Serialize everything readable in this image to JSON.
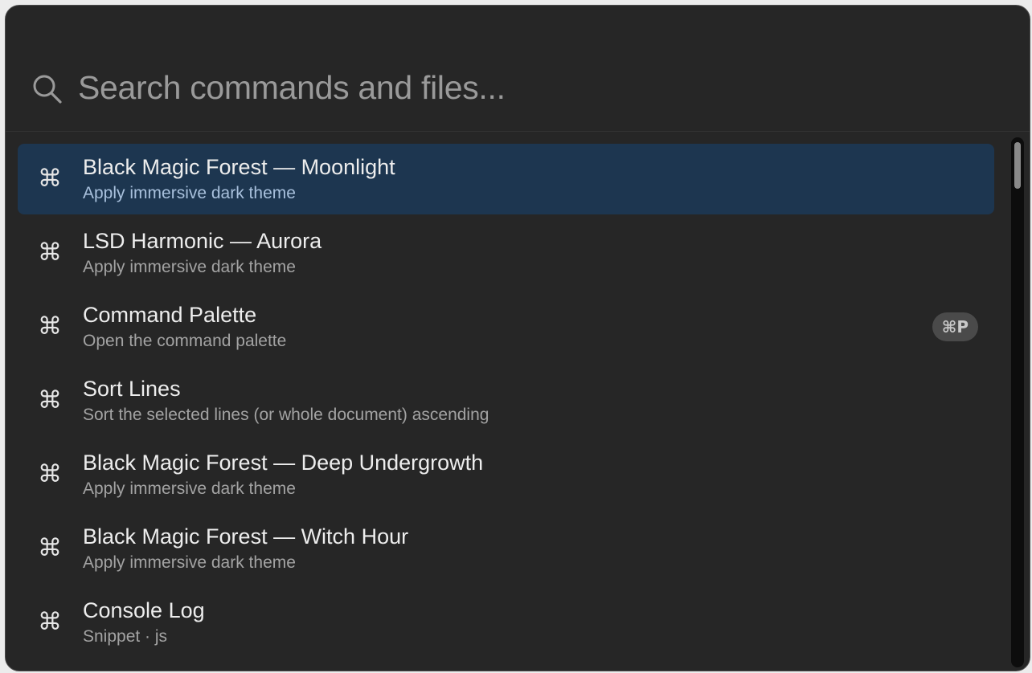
{
  "search": {
    "placeholder": "Search commands and files...",
    "icon": "search-icon"
  },
  "results": [
    {
      "icon": "command-key-icon",
      "glyph": "⌘",
      "title": "Black Magic Forest — Moonlight",
      "subtitle": "Apply immersive dark theme",
      "selected": true
    },
    {
      "icon": "command-key-icon",
      "glyph": "⌘",
      "title": "LSD Harmonic — Aurora",
      "subtitle": "Apply immersive dark theme"
    },
    {
      "icon": "command-key-icon",
      "glyph": "⌘",
      "title": "Command Palette",
      "subtitle": "Open the command palette",
      "shortcut": "⌘P"
    },
    {
      "icon": "command-key-icon",
      "glyph": "⌘",
      "title": "Sort Lines",
      "subtitle": "Sort the selected lines (or whole document) ascending"
    },
    {
      "icon": "command-key-icon",
      "glyph": "⌘",
      "title": "Black Magic Forest — Deep Undergrowth",
      "subtitle": "Apply immersive dark theme"
    },
    {
      "icon": "command-key-icon",
      "glyph": "⌘",
      "title": "Black Magic Forest — Witch Hour",
      "subtitle": "Apply immersive dark theme"
    },
    {
      "icon": "command-key-icon",
      "glyph": "⌘",
      "title": "Console Log",
      "subtitle": "Snippet · js"
    }
  ],
  "colors": {
    "panel_background": "#262626",
    "selected_row": "#1d3650",
    "selected_subtitle": "#a8c0dc",
    "title_text": "#ededed",
    "subtitle_text": "#a3a3a3",
    "badge_background": "#4a4a4a"
  }
}
